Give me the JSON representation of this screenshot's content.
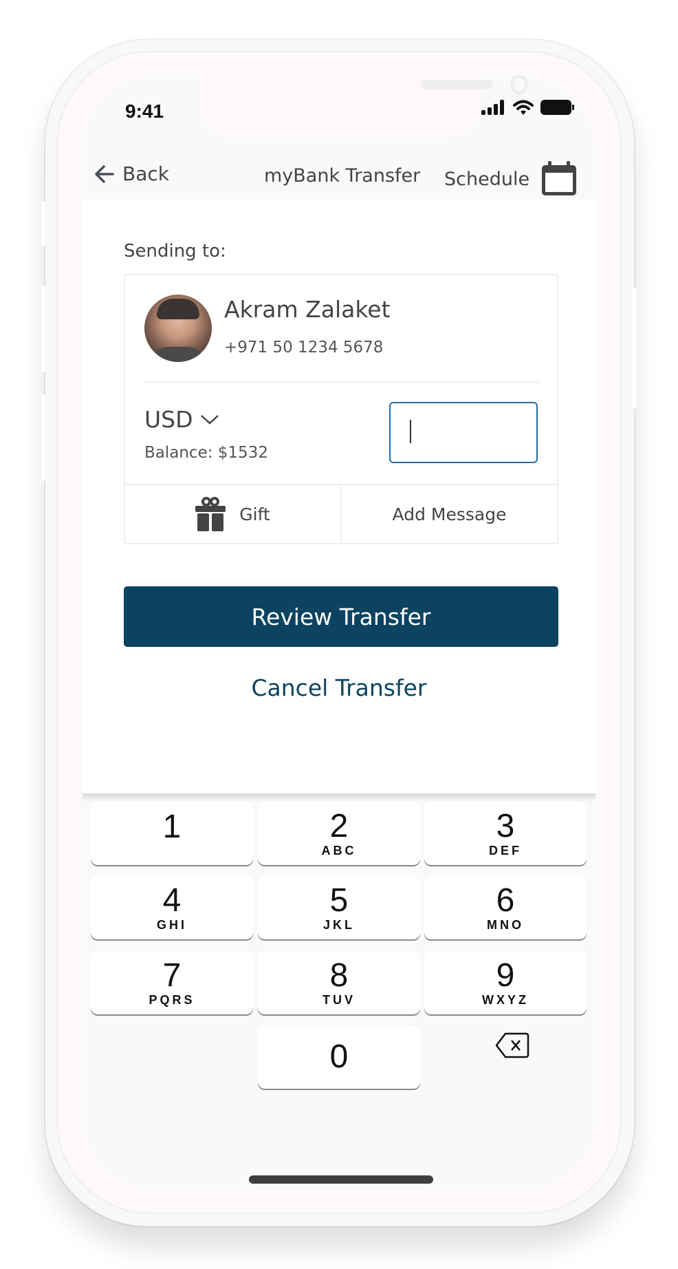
{
  "status_bar": {
    "time": "9:41",
    "icons": [
      "signal-icon",
      "wifi-icon",
      "battery-icon"
    ]
  },
  "nav": {
    "back_label": "Back",
    "title": "myBank Transfer",
    "schedule_label": "Schedule"
  },
  "transfer": {
    "sending_to_label": "Sending to:",
    "recipient": {
      "name": "Akram Zalaket",
      "phone": "+971 50 1234 5678"
    },
    "currency": "USD",
    "balance": "Balance: $1532",
    "amount_value": "",
    "actions": {
      "gift_label": "Gift",
      "message_label": "Add Message"
    }
  },
  "buttons": {
    "review": "Review Transfer",
    "cancel": "Cancel Transfer"
  },
  "colors": {
    "primary": "#0c4360",
    "input_focus": "#1f6fa8",
    "text": "#444444"
  },
  "keypad": {
    "keys": [
      {
        "num": "1",
        "letters": ""
      },
      {
        "num": "2",
        "letters": "ABC"
      },
      {
        "num": "3",
        "letters": "DEF"
      },
      {
        "num": "4",
        "letters": "GHI"
      },
      {
        "num": "5",
        "letters": "JKL"
      },
      {
        "num": "6",
        "letters": "MNO"
      },
      {
        "num": "7",
        "letters": "PQRS"
      },
      {
        "num": "8",
        "letters": "TUV"
      },
      {
        "num": "9",
        "letters": "WXYZ"
      },
      {
        "num": "0",
        "letters": ""
      }
    ]
  }
}
